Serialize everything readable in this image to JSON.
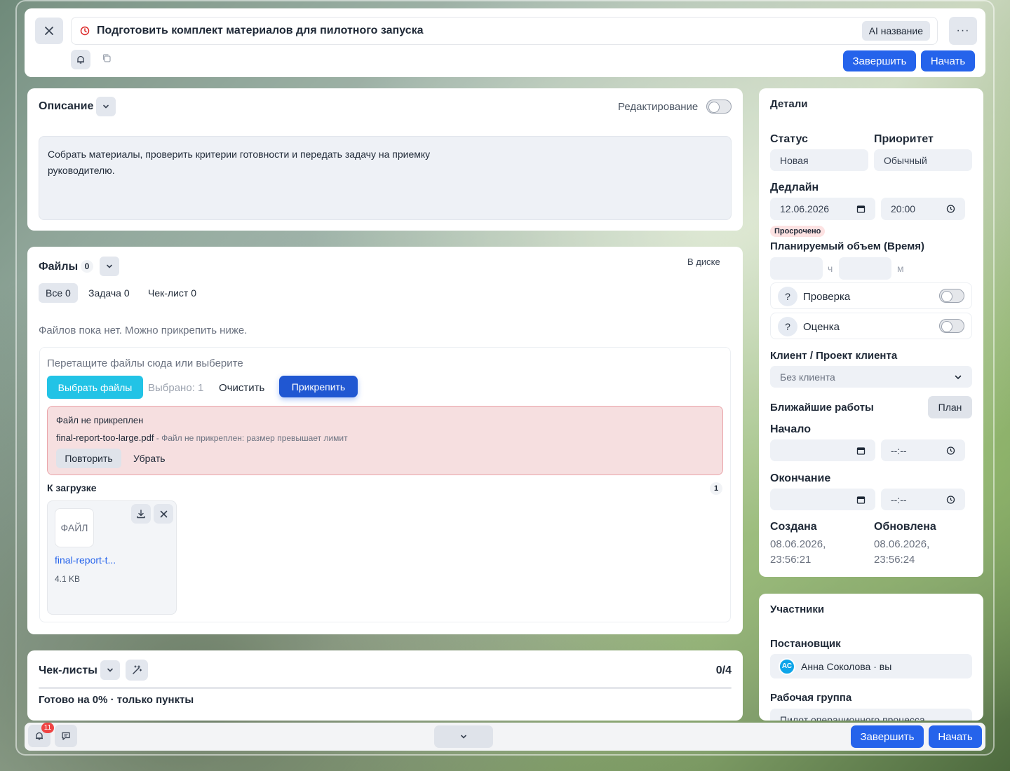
{
  "header": {
    "title": "Подготовить комплект материалов для пилотного запуска",
    "ai_label": "AI название",
    "finish_label": "Завершить",
    "start_label": "Начать"
  },
  "description": {
    "title": "Описание",
    "edit_label": "Редактирование",
    "text_line1": "Собрать материалы, проверить критерии готовности и передать задачу на приемку",
    "text_line2": "руководителю."
  },
  "files": {
    "title": "Файлы",
    "count": "0",
    "in_disk_label": "В диске",
    "tabs": [
      "Все 0",
      "Задача 0",
      "Чек-лист 0"
    ],
    "empty_text": "Файлов пока нет. Можно прикрепить ниже.",
    "dropzone_text": "Перетащите файлы сюда или выберите",
    "choose_label": "Выбрать файлы",
    "selected_text": "Выбрано: 1",
    "clear_label": "Очистить",
    "attach_label": "Прикрепить",
    "error": {
      "title": "Файл не прикреплен",
      "filename": "final-report-too-large.pdf",
      "message": " - Файл не прикреплен: размер превышает лимит",
      "retry_label": "Повторить",
      "remove_label": "Убрать"
    },
    "queue_title": "К загрузке",
    "queue_count": "1",
    "queue_item": {
      "type_label": "ФАЙЛ",
      "name": "final-report-t...",
      "size": "4.1 KB"
    }
  },
  "checklists": {
    "title": "Чек-листы",
    "progress": "0/4",
    "summary": "Готово на 0% · только пункты"
  },
  "details": {
    "title": "Детали",
    "status_label": "Статус",
    "status_value": "Новая",
    "priority_label": "Приоритет",
    "priority_value": "Обычный",
    "deadline_label": "Дедлайн",
    "deadline_date": "12.06.2026",
    "deadline_time": "20:00",
    "overdue_badge": "Просрочено",
    "planned_label": "Планируемый объем (Время)",
    "hours_unit": "ч",
    "minutes_unit": "м",
    "check_label": "Проверка",
    "rating_label": "Оценка",
    "help_glyph": "?",
    "client_label": "Клиент / Проект клиента",
    "client_value": "Без клиента",
    "nearest_label": "Ближайшие работы",
    "plan_label": "План",
    "start_label": "Начало",
    "start_time": "--:--",
    "end_label": "Окончание",
    "end_time": "--:--",
    "created_label": "Создана",
    "created_date": "08.06.2026,",
    "created_time": "23:56:21",
    "updated_label": "Обновлена",
    "updated_date": "08.06.2026,",
    "updated_time": "23:56:24"
  },
  "participants": {
    "title": "Участники",
    "creator_label": "Постановщик",
    "creator_initials": "АС",
    "creator_name": "Анна Соколова · вы",
    "group_label": "Рабочая группа",
    "group_value": "Пилот операционного процесса"
  },
  "footer": {
    "notif_count": "11",
    "finish_label": "Завершить",
    "start_label": "Начать"
  },
  "colors": {
    "accent": "#2563eb",
    "cyan": "#22c3e6",
    "error_bg": "#f6dfe0",
    "overdue_bg": "#fde2e2"
  }
}
